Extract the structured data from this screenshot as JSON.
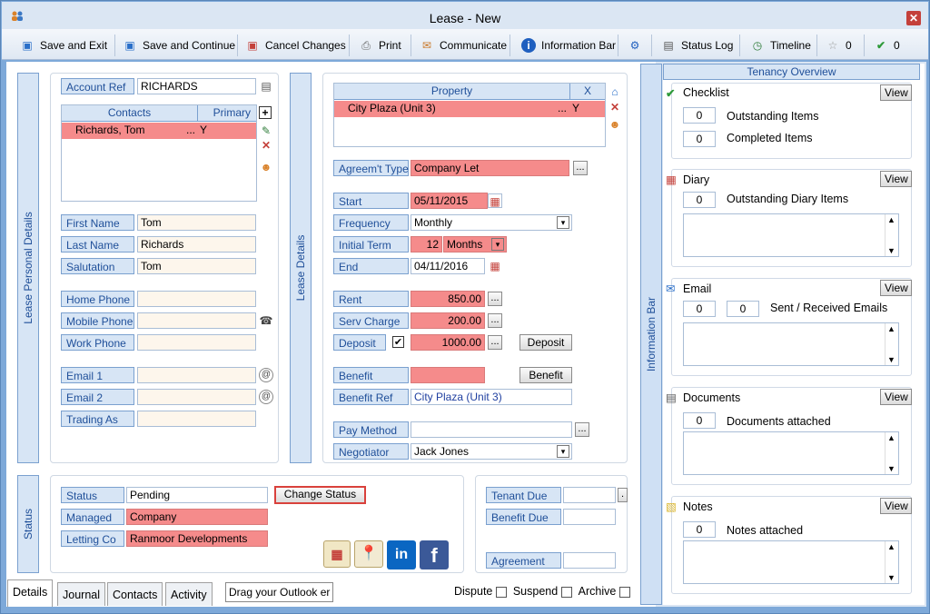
{
  "window": {
    "title": "Lease - New"
  },
  "toolbar": {
    "save_exit": "Save and Exit",
    "save_continue": "Save and Continue",
    "cancel": "Cancel Changes",
    "print": "Print",
    "communicate": "Communicate",
    "info_bar": "Information Bar",
    "status_log": "Status Log",
    "timeline": "Timeline",
    "star_count": "0",
    "check_count": "0"
  },
  "personal": {
    "section_label": "Lease Personal Details",
    "account_ref_label": "Account Ref",
    "account_ref": "RICHARDS",
    "contacts_header": "Contacts",
    "primary_header": "Primary",
    "contacts": [
      {
        "name": "Richards, Tom",
        "dots": "...",
        "primary": "Y"
      }
    ],
    "first_name_label": "First Name",
    "first_name": "Tom",
    "last_name_label": "Last Name",
    "last_name": "Richards",
    "salutation_label": "Salutation",
    "salutation": "Tom",
    "home_phone_label": "Home Phone",
    "home_phone": "",
    "mobile_phone_label": "Mobile Phone",
    "mobile_phone": "",
    "work_phone_label": "Work Phone",
    "work_phone": "",
    "email1_label": "Email 1",
    "email1": "",
    "email2_label": "Email 2",
    "email2": "",
    "trading_as_label": "Trading As",
    "trading_as": ""
  },
  "lease": {
    "section_label": "Lease Details",
    "property_header": "Property",
    "x_header": "X",
    "properties": [
      {
        "name": "City Plaza (Unit 3)",
        "dots": "...",
        "x": "Y"
      }
    ],
    "agreement_type_label": "Agreem't Type",
    "agreement_type": "Company Let",
    "start_label": "Start",
    "start": "05/11/2015",
    "frequency_label": "Frequency",
    "frequency": "Monthly",
    "initial_term_label": "Initial Term",
    "initial_term": "12",
    "initial_term_unit": "Months",
    "end_label": "End",
    "end": "04/11/2016",
    "rent_label": "Rent",
    "rent": "850.00",
    "serv_charge_label": "Serv Charge",
    "serv_charge": "200.00",
    "deposit_label": "Deposit",
    "deposit": "1000.00",
    "deposit_button": "Deposit",
    "benefit_label": "Benefit",
    "benefit": "",
    "benefit_button": "Benefit",
    "benefit_ref_label": "Benefit Ref",
    "benefit_ref": "City Plaza (Unit 3)",
    "pay_method_label": "Pay Method",
    "pay_method": "",
    "negotiator_label": "Negotiator",
    "negotiator": "Jack Jones"
  },
  "status": {
    "section_label": "Status",
    "status_label": "Status",
    "status": "Pending",
    "change_status_button": "Change Status",
    "managed_label": "Managed",
    "managed": "Company",
    "letting_co_label": "Letting Co",
    "letting_co": "Ranmoor Developments",
    "tenant_due_label": "Tenant Due",
    "tenant_due": "",
    "benefit_due_label": "Benefit Due",
    "benefit_due": "",
    "agreement_label": "Agreement",
    "agreement": ""
  },
  "info_bar": {
    "label": "Information Bar",
    "header": "Tenancy Overview",
    "view": "View",
    "checklist": {
      "title": "Checklist",
      "outstanding": "0",
      "outstanding_label": "Outstanding Items",
      "completed": "0",
      "completed_label": "Completed Items"
    },
    "diary": {
      "title": "Diary",
      "count": "0",
      "label": "Outstanding Diary Items"
    },
    "email": {
      "title": "Email",
      "sent": "0",
      "received": "0",
      "label": "Sent / Received Emails"
    },
    "documents": {
      "title": "Documents",
      "count": "0",
      "label": "Documents attached"
    },
    "notes": {
      "title": "Notes",
      "count": "0",
      "label": "Notes attached"
    }
  },
  "tabs": [
    "Details",
    "Journal",
    "Contacts",
    "Activity"
  ],
  "outlook_drop": "Drag your Outlook er",
  "flags": {
    "dispute": "Dispute",
    "suspend": "Suspend",
    "archive": "Archive"
  },
  "colors": {
    "accent_label_bg": "#d7e5f5",
    "required_pink": "#f58b8b",
    "frame_blue": "#7ea9d9"
  }
}
